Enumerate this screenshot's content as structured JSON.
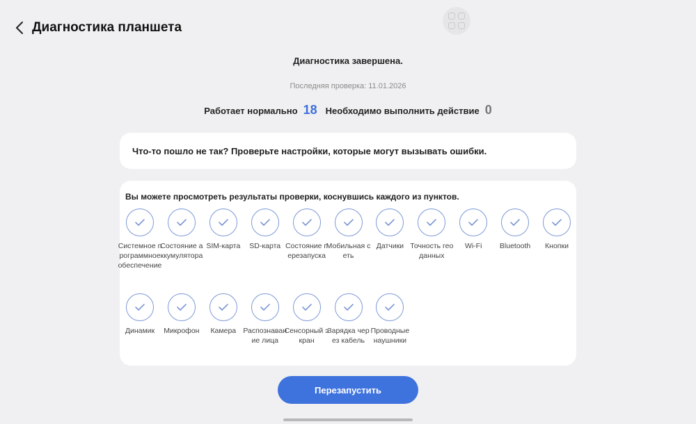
{
  "header": {
    "title": "Диагностика планшета"
  },
  "summary": {
    "status": "Диагностика завершена.",
    "last_check": "Последняя проверка: 11.01.2026",
    "ok_label": "Работает нормально",
    "ok_count": "18",
    "action_label": "Необходимо выполнить действие",
    "action_count": "0"
  },
  "warning_card": {
    "text": "Что-то пошло не так? Проверьте настройки, которые могут вызывать ошибки."
  },
  "results": {
    "hint": "Вы можете просмотреть результаты проверки, коснувшись каждого из пунктов.",
    "items": [
      {
        "label": "Системное программное обеспечение"
      },
      {
        "label": "Состояние аккумулятора"
      },
      {
        "label": "SIM-карта"
      },
      {
        "label": "SD-карта"
      },
      {
        "label": "Состояние перезапуска"
      },
      {
        "label": "Мобильная сеть"
      },
      {
        "label": "Датчики"
      },
      {
        "label": "Точность геоданных"
      },
      {
        "label": "Wi-Fi"
      },
      {
        "label": "Bluetooth"
      },
      {
        "label": "Кнопки"
      },
      {
        "label": "Динамик"
      },
      {
        "label": "Микрофон"
      },
      {
        "label": "Камера"
      },
      {
        "label": "Распознавание лица"
      },
      {
        "label": "Сенсорный экран"
      },
      {
        "label": "Зарядка через кабель"
      },
      {
        "label": "Проводные наушники"
      }
    ]
  },
  "footer": {
    "restart_label": "Перезапустить"
  },
  "colors": {
    "accent": "#3e72dd",
    "check_ring": "#7d98d6",
    "background": "#f0f0f2"
  }
}
